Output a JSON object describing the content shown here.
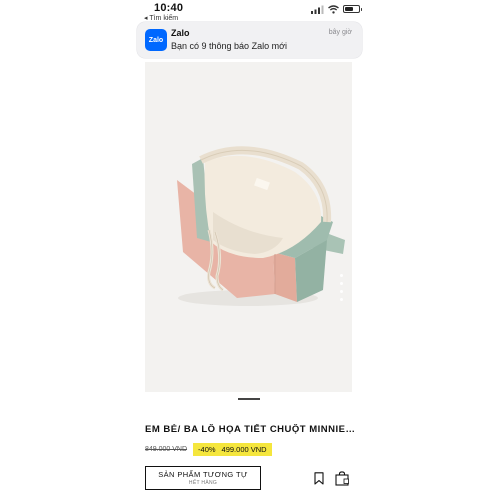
{
  "status_bar": {
    "time": "10:40",
    "back_label": "◂ Tìm kiếm",
    "battery_level": 0.6
  },
  "notification": {
    "app_name": "Zalo",
    "icon_label": "Zalo",
    "time": "bây giờ",
    "message": "Bạn có 9 thông báo Zalo mới"
  },
  "product": {
    "title": "EM BÉ/ BA LÔ HỌA TIẾT CHUỘT MINNIE ©DIS...",
    "old_price": "849.000 VND",
    "discount": "-40%",
    "price": "499.000 VND",
    "image_count": 4
  },
  "actions": {
    "similar_label": "SẢN PHẨM TƯƠNG TỰ",
    "similar_sublabel": "HẾT HÀNG",
    "bookmark_icon": "bookmark-icon",
    "bag_icon": "shopping-bag-icon"
  }
}
